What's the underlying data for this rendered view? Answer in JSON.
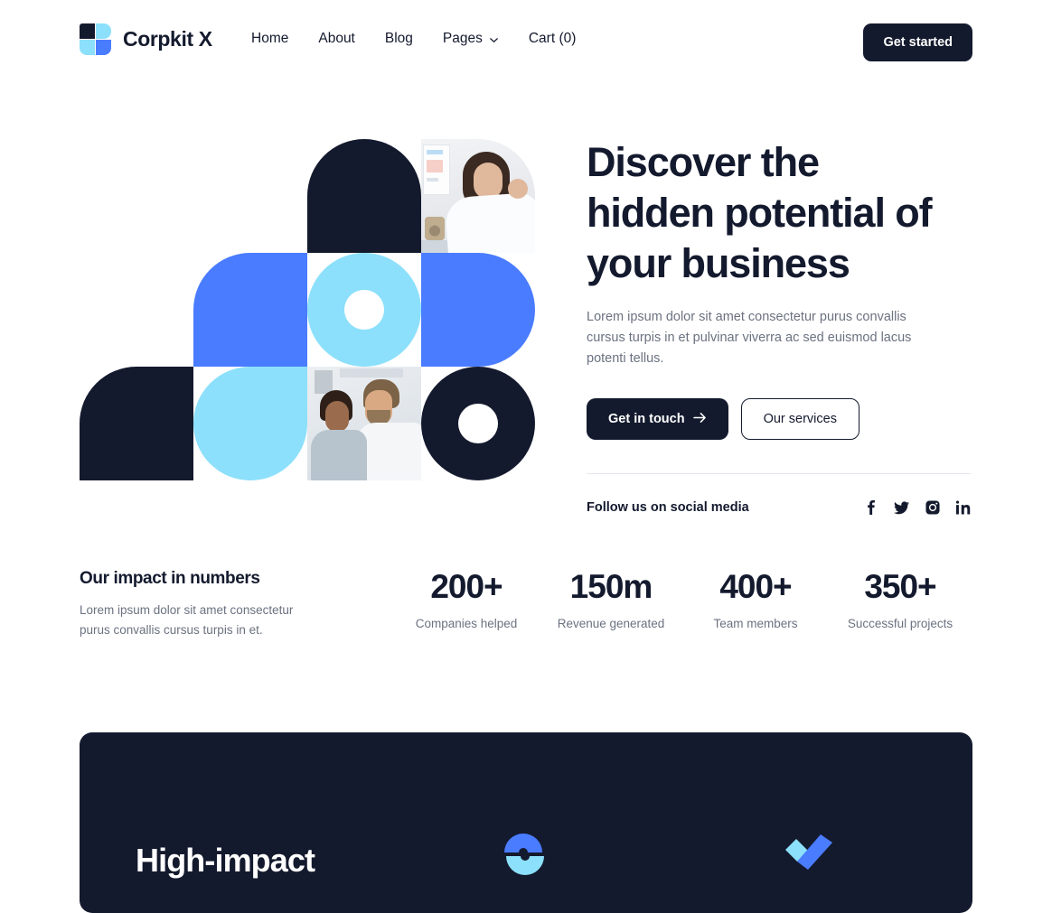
{
  "brand": {
    "name": "Corpkit X",
    "logo_icon": "four-square-logo-icon"
  },
  "nav": {
    "items": [
      {
        "label": "Home",
        "has_dropdown": false
      },
      {
        "label": "About",
        "has_dropdown": false
      },
      {
        "label": "Blog",
        "has_dropdown": false
      },
      {
        "label": "Pages",
        "has_dropdown": true,
        "icon": "chevron-down-icon"
      },
      {
        "label": "Cart (0)",
        "has_dropdown": false
      }
    ],
    "cta_label": "Get started"
  },
  "hero": {
    "heading": "Discover the hidden potential of your business",
    "paragraph": "Lorem ipsum dolor sit amet consectetur purus convallis cursus turpis in et pulvinar viverra ac sed euismod lacus potenti tellus.",
    "primary_button": "Get in touch",
    "primary_button_icon": "arrow-right-icon",
    "secondary_button": "Our services",
    "social_label": "Follow us on social media",
    "social_icons": [
      {
        "name": "facebook-icon"
      },
      {
        "name": "twitter-icon"
      },
      {
        "name": "instagram-icon"
      },
      {
        "name": "linkedin-icon"
      }
    ]
  },
  "stats": {
    "title": "Our impact in numbers",
    "subtitle": "Lorem ipsum dolor sit amet consectetur purus convallis cursus turpis in et.",
    "items": [
      {
        "value": "200+",
        "label": "Companies helped"
      },
      {
        "value": "150m",
        "label": "Revenue generated"
      },
      {
        "value": "400+",
        "label": "Team members"
      },
      {
        "value": "350+",
        "label": "Successful projects"
      }
    ]
  },
  "dark_section": {
    "heading": "High-impact",
    "decorations": [
      {
        "name": "interlocking-rings-icon"
      },
      {
        "name": "checkmark-icon"
      }
    ]
  },
  "colors": {
    "navy": "#141a2e",
    "blue": "#4a7cff",
    "sky": "#8ce0fb",
    "muted_text": "#6b7280",
    "page_background": "#ffffff"
  }
}
